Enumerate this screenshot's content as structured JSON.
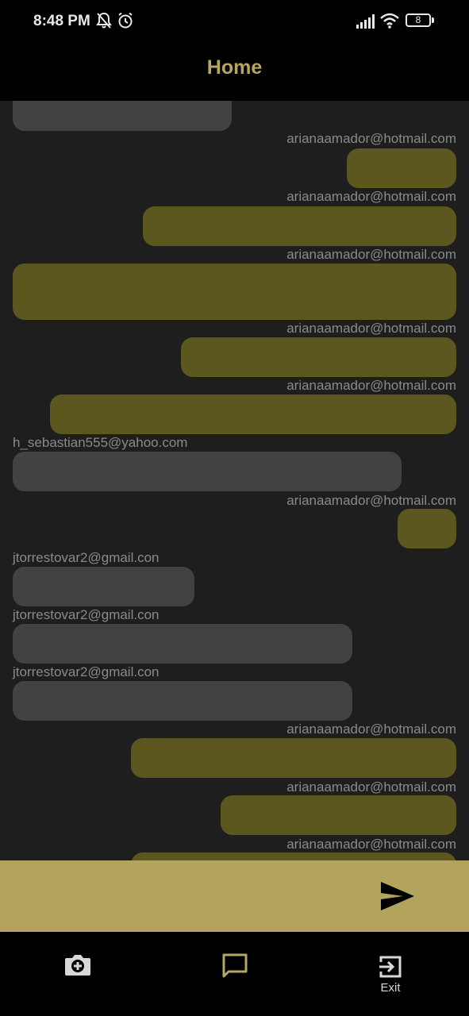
{
  "status_bar": {
    "time": "8:48 PM",
    "battery": "8"
  },
  "app_bar": {
    "title": "Home"
  },
  "messages": [
    {
      "sender": "arianaamador@hotmail.com",
      "own": true
    },
    {
      "sender": "arianaamador@hotmail.com",
      "own": true
    },
    {
      "sender": "arianaamador@hotmail.com",
      "own": true
    },
    {
      "sender": "arianaamador@hotmail.com",
      "own": true
    },
    {
      "sender": "arianaamador@hotmail.com",
      "own": true
    },
    {
      "sender": "h_sebastian555@yahoo.com",
      "own": false
    },
    {
      "sender": "arianaamador@hotmail.com",
      "own": true
    },
    {
      "sender": "jtorrestovar2@gmail.con",
      "own": false
    },
    {
      "sender": "jtorrestovar2@gmail.con",
      "own": false
    },
    {
      "sender": "jtorrestovar2@gmail.con",
      "own": false
    },
    {
      "sender": "arianaamador@hotmail.com",
      "own": true
    },
    {
      "sender": "arianaamador@hotmail.com",
      "own": true
    },
    {
      "sender": "arianaamador@hotmail.com",
      "own": true
    }
  ],
  "bottom_nav": {
    "items": [
      {
        "icon": "add-photo-camera-icon",
        "label": ""
      },
      {
        "icon": "chat-bubble-icon",
        "label": ""
      },
      {
        "icon": "exit-icon",
        "label": "Exit"
      }
    ]
  },
  "colors": {
    "own_bubble": "#5c571f",
    "other_bubble": "#424242",
    "accent": "#b6a661",
    "composer": "#b2a45c"
  }
}
